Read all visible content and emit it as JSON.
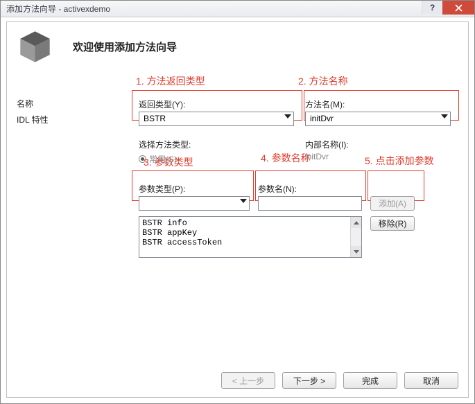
{
  "window": {
    "title": "添加方法向导 - activexdemo"
  },
  "header": {
    "title": "欢迎使用添加方法向导"
  },
  "nav": {
    "items": [
      "名称",
      "IDL 特性"
    ]
  },
  "annotations": {
    "a1": "1. 方法返回类型",
    "a2": "2. 方法名称",
    "a3": "3. 参数类型",
    "a4": "4. 参数名称",
    "a5": "5. 点击添加参数"
  },
  "form": {
    "returnTypeLabel": "返回类型(Y):",
    "returnTypeValue": "BSTR",
    "methodNameLabel": "方法名(M):",
    "methodNameValue": "initDvr",
    "selectMethodTypeLabel": "选择方法类型:",
    "radioCommonLabel": "常用(S)",
    "internalNameLabel": "内部名称(I):",
    "internalNameValue": "initDvr",
    "paramTypeLabel": "参数类型(P):",
    "paramNameLabel": "参数名(N):",
    "addBtn": "添加(A)",
    "removeBtn": "移除(R)",
    "paramsList": [
      "BSTR info",
      "BSTR appKey",
      "BSTR accessToken"
    ]
  },
  "footer": {
    "prev": "< 上一步",
    "next": "下一步 >",
    "finish": "完成",
    "cancel": "取消"
  }
}
